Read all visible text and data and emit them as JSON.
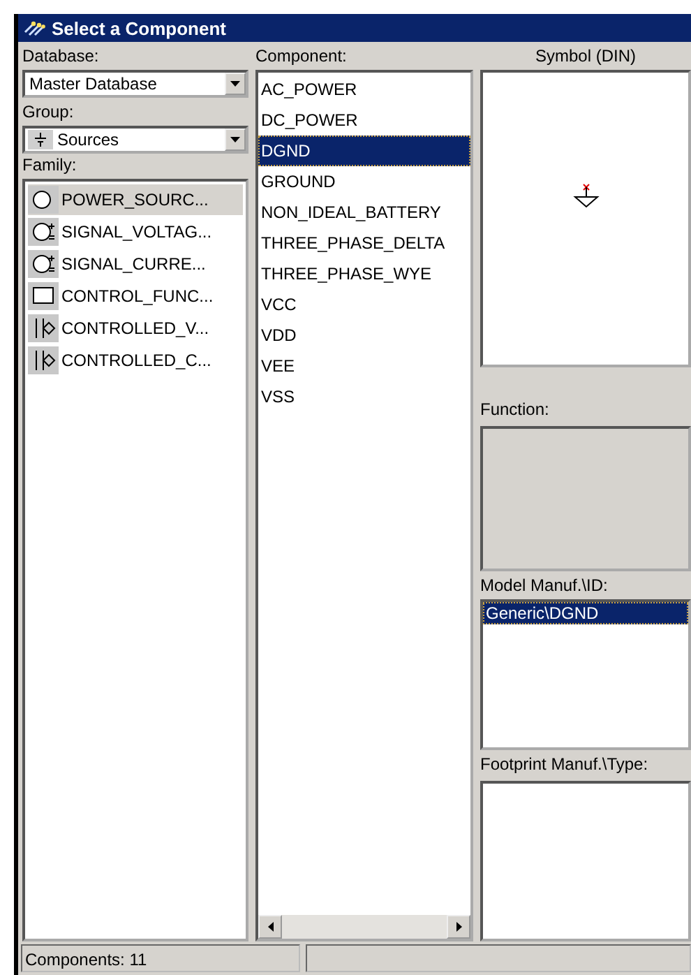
{
  "window": {
    "title": "Select a Component"
  },
  "database": {
    "label": "Database:",
    "value": "Master Database"
  },
  "group": {
    "label": "Group:",
    "value": "Sources"
  },
  "family": {
    "label": "Family:",
    "items": [
      {
        "label": "POWER_SOURC...",
        "selected": true
      },
      {
        "label": "SIGNAL_VOLTAG...",
        "selected": false
      },
      {
        "label": "SIGNAL_CURRE...",
        "selected": false
      },
      {
        "label": "CONTROL_FUNC...",
        "selected": false
      },
      {
        "label": "CONTROLLED_V...",
        "selected": false
      },
      {
        "label": "CONTROLLED_C...",
        "selected": false
      }
    ]
  },
  "component": {
    "label": "Component:",
    "items": [
      {
        "label": "AC_POWER",
        "selected": false
      },
      {
        "label": "DC_POWER",
        "selected": false
      },
      {
        "label": "DGND",
        "selected": true
      },
      {
        "label": "GROUND",
        "selected": false
      },
      {
        "label": "NON_IDEAL_BATTERY",
        "selected": false
      },
      {
        "label": "THREE_PHASE_DELTA",
        "selected": false
      },
      {
        "label": "THREE_PHASE_WYE",
        "selected": false
      },
      {
        "label": "VCC",
        "selected": false
      },
      {
        "label": "VDD",
        "selected": false
      },
      {
        "label": "VEE",
        "selected": false
      },
      {
        "label": "VSS",
        "selected": false
      }
    ]
  },
  "symbol": {
    "label": "Symbol (DIN)"
  },
  "function": {
    "label": "Function:"
  },
  "model": {
    "label": "Model Manuf.\\ID:",
    "items": [
      {
        "label": "Generic\\DGND",
        "selected": true
      }
    ]
  },
  "footprint": {
    "label": "Footprint Manuf.\\Type:"
  },
  "status_bar": {
    "text": "Components: 11"
  }
}
